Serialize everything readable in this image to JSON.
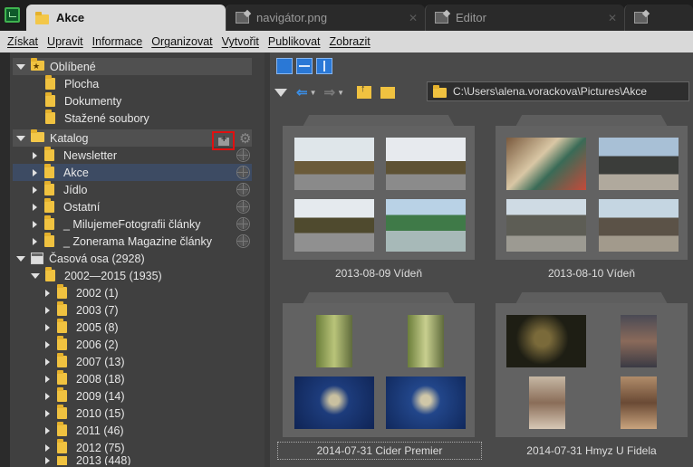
{
  "tabs": [
    {
      "label": "Akce",
      "active": true
    },
    {
      "label": "navigátor.png",
      "active": false
    },
    {
      "label": "Editor",
      "active": false
    }
  ],
  "menu": [
    "Získat",
    "Upravit",
    "Informace",
    "Organizovat",
    "Vytvořit",
    "Publikovat",
    "Zobrazit"
  ],
  "tree": {
    "favorites": {
      "label": "Oblíbené",
      "items": [
        "Plocha",
        "Dokumenty",
        "Stažené soubory"
      ]
    },
    "catalog": {
      "label": "Katalog",
      "items": [
        "Newsletter",
        "Akce",
        "Jídlo",
        "Ostatní",
        "_ MilujemeFotografii články",
        "_ Zonerama Magazine články"
      ],
      "selected": "Akce"
    },
    "timeline": {
      "label": "Časová osa (2928)",
      "range": "2002—2015 (1935)",
      "years": [
        "2002 (1)",
        "2003 (7)",
        "2005 (8)",
        "2006 (2)",
        "2007 (13)",
        "2008 (18)",
        "2009 (14)",
        "2010 (15)",
        "2011 (46)",
        "2012 (75)",
        "2013 (448)"
      ]
    }
  },
  "path": "C:\\Users\\alena.vorackova\\Pictures\\Akce",
  "folders": [
    {
      "label": "2013-08-09 Vídeň"
    },
    {
      "label": "2013-08-10 Vídeň"
    },
    {
      "label": "2014-07-31 Cider Premier",
      "selected": true
    },
    {
      "label": "2014-07-31 Hmyz U Fidela"
    }
  ],
  "colors": {
    "accent": "#2a78d6",
    "highlight": "#e01010",
    "folder": "#f0c240",
    "selection": "#3d4b63"
  }
}
